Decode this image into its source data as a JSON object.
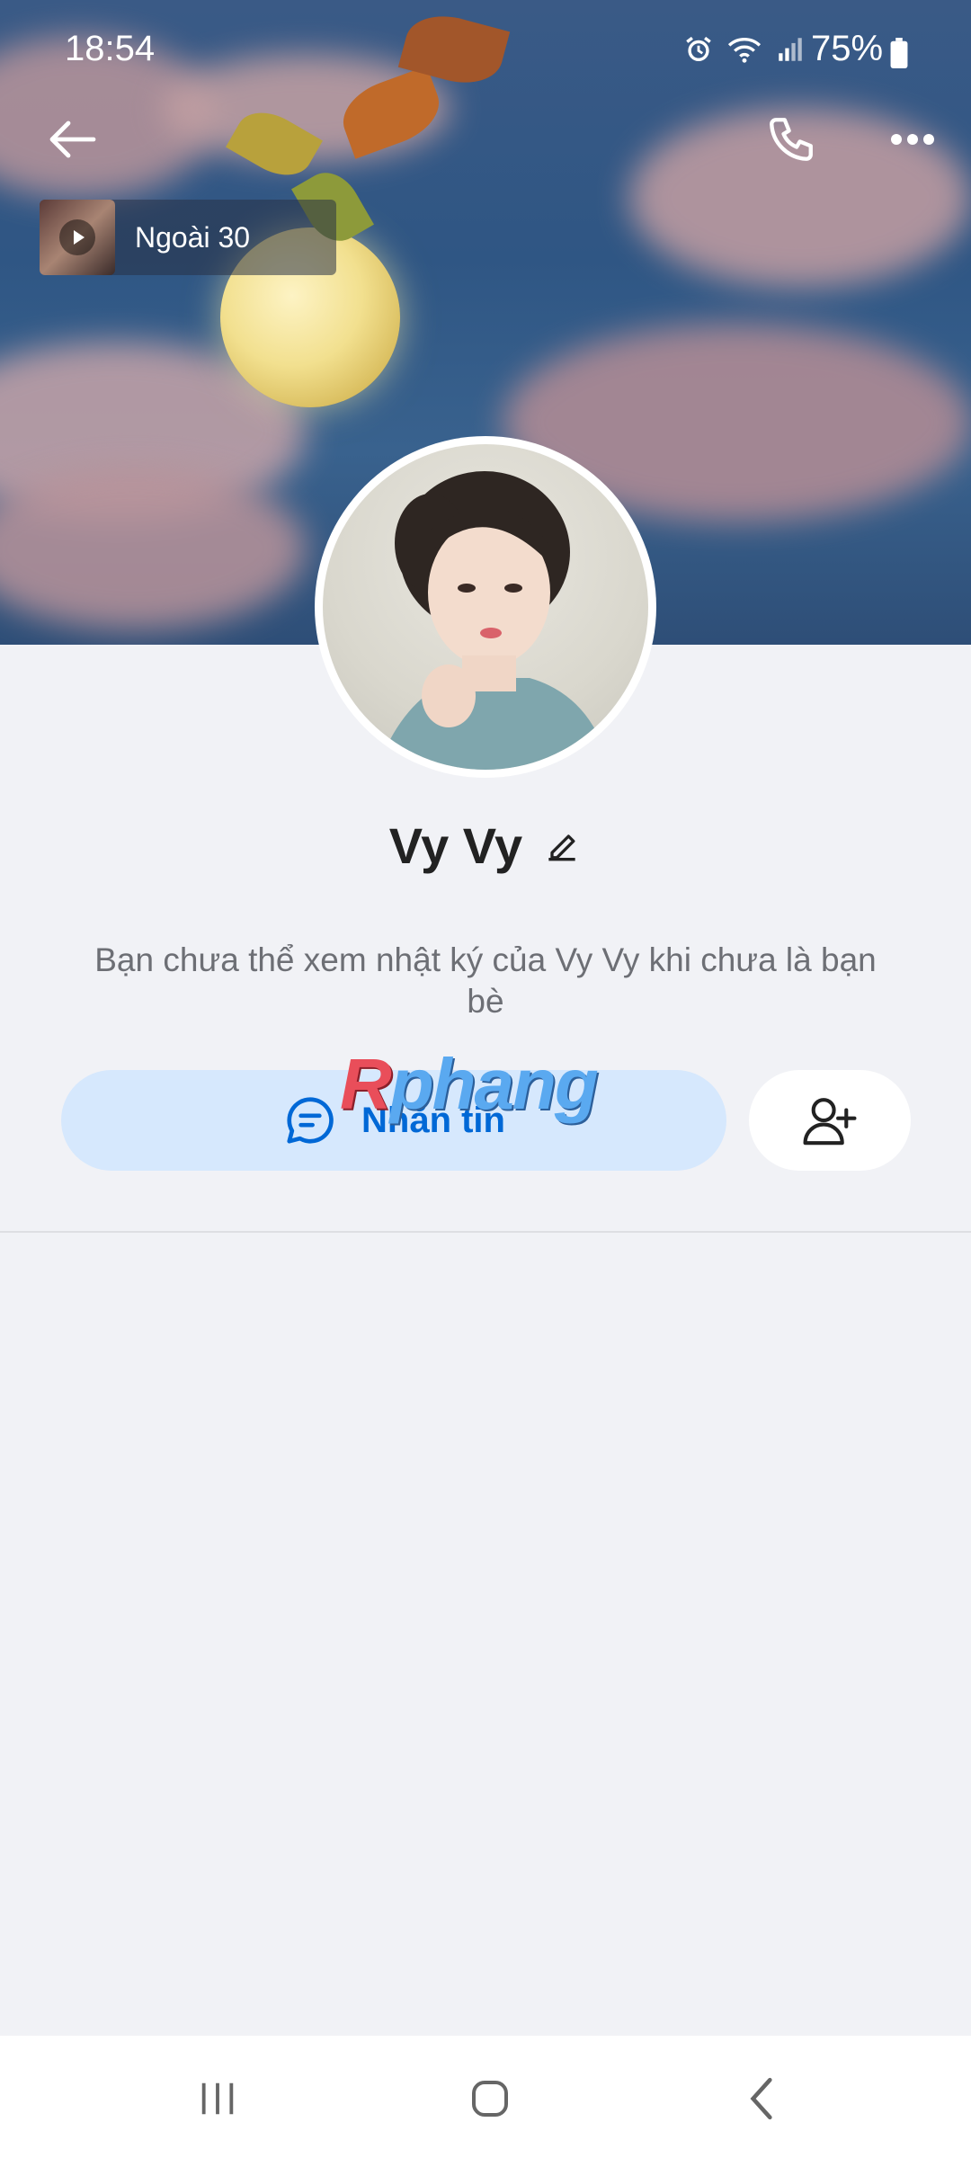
{
  "status_bar": {
    "time": "18:54",
    "battery": "75%"
  },
  "music": {
    "title": "Ngoài 30"
  },
  "profile": {
    "name": "Vy Vy",
    "notice": "Bạn chưa thể xem nhật ký của Vy Vy khi chưa là bạn bè"
  },
  "actions": {
    "message_label": "Nhắn tin"
  },
  "watermark": {
    "part1": "R",
    "part2": "phang"
  },
  "colors": {
    "accent": "#0068d6",
    "message_bg": "#d6e8fd",
    "page_bg": "#f1f2f6"
  },
  "icons": {
    "back": "arrow-left-icon",
    "call": "phone-icon",
    "more": "more-horizontal-icon",
    "edit": "pencil-icon",
    "chat": "chat-bubble-icon",
    "add_friend": "user-plus-icon"
  }
}
